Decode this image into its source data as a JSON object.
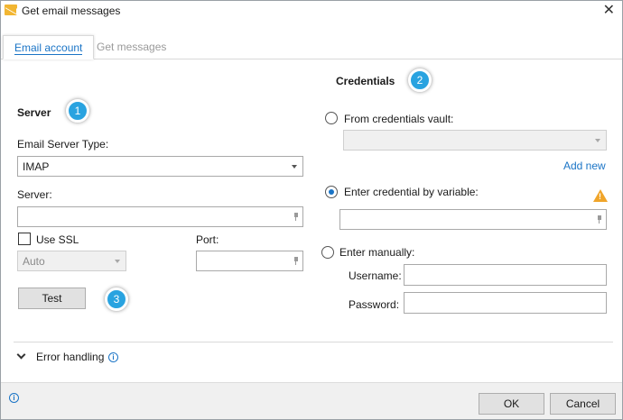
{
  "window": {
    "title": "Get email messages",
    "icon": "email-envelope-icon",
    "close_glyph": "✕"
  },
  "tabs": [
    {
      "label": "Email account",
      "active": true
    },
    {
      "label": "Get messages",
      "active": false
    }
  ],
  "server": {
    "heading": "Server",
    "badge": "1",
    "type_label": "Email Server Type:",
    "type_value": "IMAP",
    "server_label": "Server:",
    "server_value": "",
    "use_ssl_label": "Use SSL",
    "use_ssl_checked": false,
    "ssl_mode_value": "Auto",
    "port_label": "Port:",
    "port_value": "",
    "test_label": "Test",
    "test_badge": "3"
  },
  "credentials": {
    "heading": "Credentials",
    "badge": "2",
    "vault_label": "From credentials vault:",
    "vault_value": "",
    "add_new_label": "Add new",
    "variable_label": "Enter credential by variable:",
    "variable_value": "",
    "manual_label": "Enter manually:",
    "username_label": "Username:",
    "username_value": "",
    "password_label": "Password:",
    "password_value": "",
    "selected_option": "variable"
  },
  "error_handling": {
    "label": "Error handling"
  },
  "footer": {
    "ok_label": "OK",
    "cancel_label": "Cancel"
  },
  "colors": {
    "accent": "#1a74c6",
    "badge": "#29a3e0",
    "warning": "#f0a52a",
    "footer_bg": "#f0f0f0"
  }
}
